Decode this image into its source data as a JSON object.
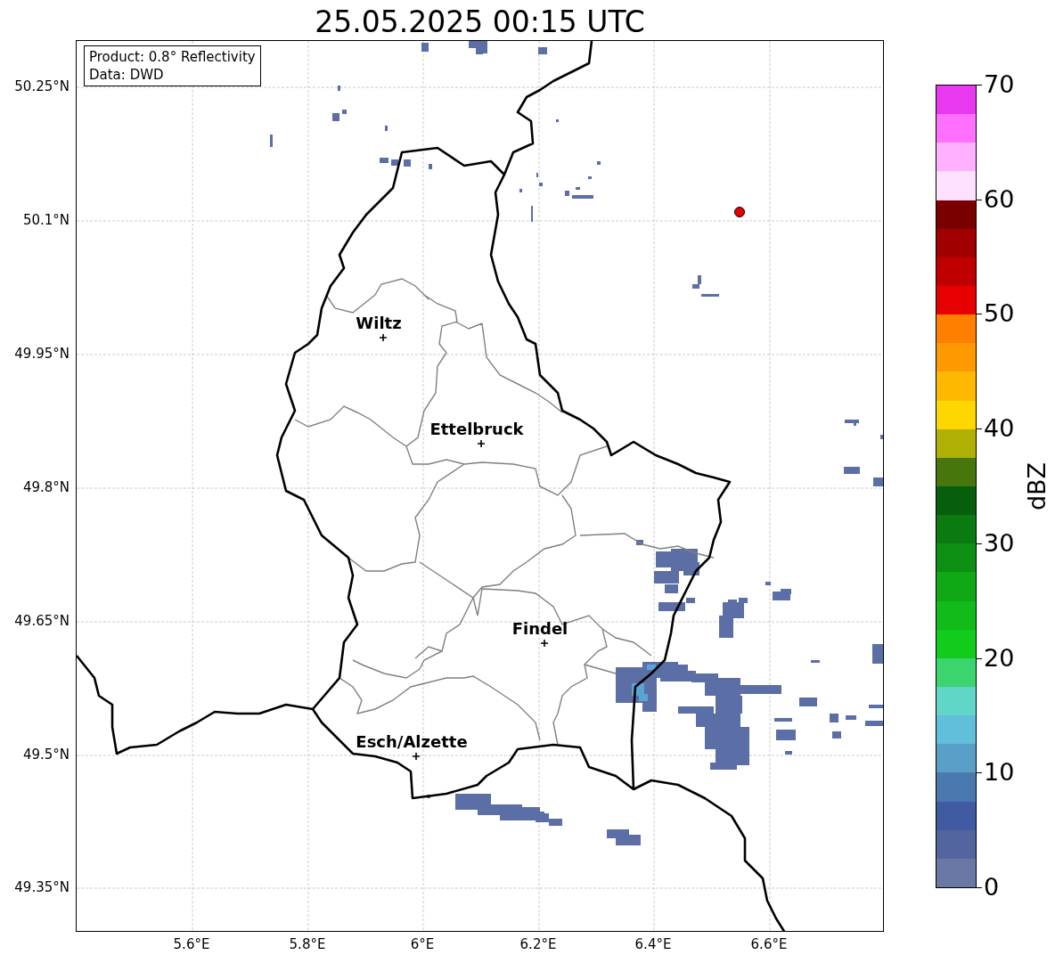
{
  "title": "25.05.2025 00:15 UTC",
  "info_box": [
    "Product: 0.8° Reflectivity",
    "Data: DWD"
  ],
  "y_ticks": [
    "50.25°N",
    "50.1°N",
    "49.95°N",
    "49.8°N",
    "49.65°N",
    "49.5°N",
    "49.35°N"
  ],
  "x_ticks": [
    "5.6°E",
    "5.8°E",
    "6°E",
    "6.2°E",
    "6.4°E",
    "6.6°E"
  ],
  "cities": [
    {
      "name": "Wiltz"
    },
    {
      "name": "Ettelbruck"
    },
    {
      "name": "Findel"
    },
    {
      "name": "Esch/Alzette"
    }
  ],
  "colorbar": {
    "label": "dBZ",
    "ticks": [
      "70",
      "60",
      "50",
      "40",
      "30",
      "20",
      "10",
      "0"
    ],
    "segments": [
      {
        "color": "#6a78a6"
      },
      {
        "color": "#52659e"
      },
      {
        "color": "#3f5aa0"
      },
      {
        "color": "#4a79b0"
      },
      {
        "color": "#599fc8"
      },
      {
        "color": "#62bfdc"
      },
      {
        "color": "#5fd6c7"
      },
      {
        "color": "#3bd46e"
      },
      {
        "color": "#12cc1c"
      },
      {
        "color": "#11bb1a"
      },
      {
        "color": "#10a815"
      },
      {
        "color": "#0d8f13"
      },
      {
        "color": "#0b7a10"
      },
      {
        "color": "#075e0d"
      },
      {
        "color": "#47760c"
      },
      {
        "color": "#b0b005"
      },
      {
        "color": "#ffd700"
      },
      {
        "color": "#ffb800"
      },
      {
        "color": "#ff9900"
      },
      {
        "color": "#ff7f00"
      },
      {
        "color": "#e60000"
      },
      {
        "color": "#c00000"
      },
      {
        "color": "#a00000"
      },
      {
        "color": "#7a0000"
      },
      {
        "color": "#ffe0ff"
      },
      {
        "color": "#ffb0ff"
      },
      {
        "color": "#ff70ff"
      },
      {
        "color": "#e838f0"
      }
    ]
  }
}
